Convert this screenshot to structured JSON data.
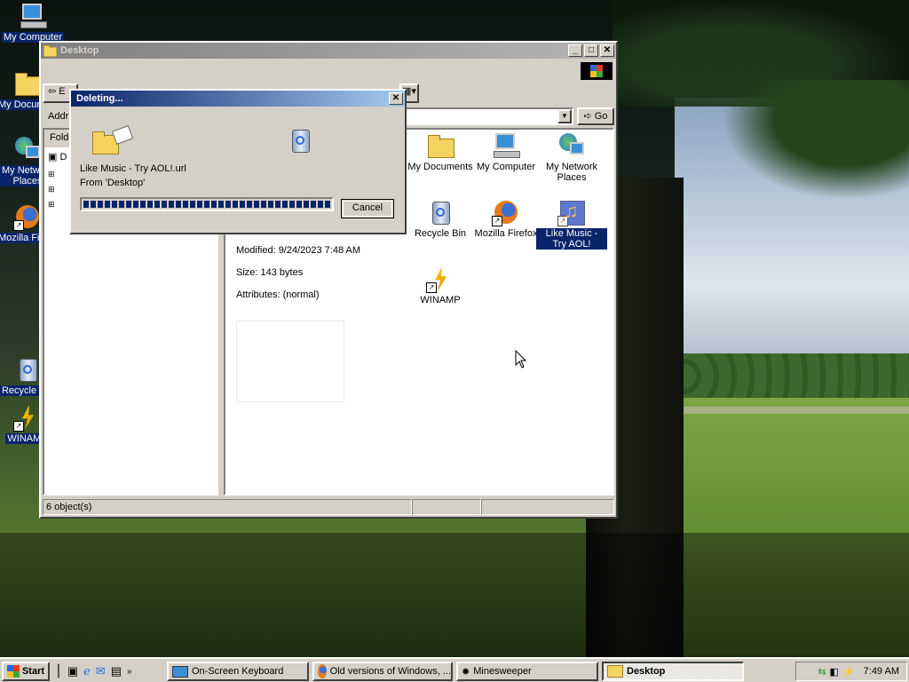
{
  "desktop": {
    "icons": [
      {
        "label": "My Computer",
        "icon": "computer-icon"
      },
      {
        "label": "My Documents",
        "icon": "folder-icon"
      },
      {
        "label": "My Network Places",
        "icon": "network-icon"
      },
      {
        "label": "Mozilla Firefox",
        "icon": "firefox-icon"
      },
      {
        "label": "Recycle Bin",
        "icon": "recycle-bin-icon"
      },
      {
        "label": "WINAMP",
        "icon": "winamp-icon"
      }
    ]
  },
  "explorer": {
    "title": "Desktop",
    "menu_partial": "E",
    "address_label": "Addr",
    "go_label": "Go",
    "folders_label": "Folde",
    "tree_root": "D",
    "details": {
      "modified": "Modified: 9/24/2023 7:48 AM",
      "size": "Size: 143 bytes",
      "attributes": "Attributes: (normal)"
    },
    "items": [
      {
        "label": "My Documents",
        "icon": "folder-icon"
      },
      {
        "label": "My Computer",
        "icon": "computer-icon"
      },
      {
        "label": "My Network Places",
        "icon": "network-icon"
      },
      {
        "label": "Recycle Bin",
        "icon": "recycle-bin-icon"
      },
      {
        "label": "Mozilla Firefox",
        "icon": "firefox-icon"
      },
      {
        "label": "Like Music - Try AOL!",
        "icon": "aol-music-icon",
        "selected": true
      },
      {
        "label": "WINAMP",
        "icon": "winamp-icon"
      }
    ],
    "status": "6 object(s)"
  },
  "dialog": {
    "title": "Deleting...",
    "file": "Like Music - Try AOL!.url",
    "from": "From 'Desktop'",
    "progress": 1.0,
    "cancel_label": "Cancel",
    "close_glyph": "✕"
  },
  "taskbar": {
    "start_label": "Start",
    "tasks": [
      {
        "label": "On-Screen Keyboard",
        "icon": "keyboard-icon",
        "active": false
      },
      {
        "label": "Old versions of Windows, ...",
        "icon": "firefox-icon",
        "active": false
      },
      {
        "label": "Minesweeper",
        "icon": "minesweeper-icon",
        "active": false
      },
      {
        "label": "Desktop",
        "icon": "folder-icon",
        "active": true
      }
    ],
    "clock": "7:49 AM"
  },
  "window_controls": {
    "minimize": "_",
    "maximize": "□",
    "close": "✕"
  }
}
